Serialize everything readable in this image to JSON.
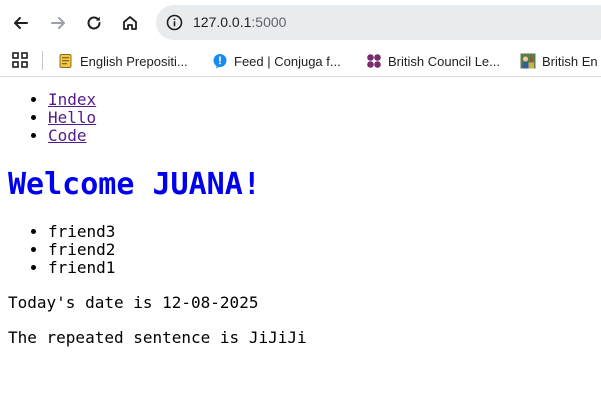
{
  "browser": {
    "url_host": "127.0.0.1",
    "url_port": ":5000",
    "bookmarks": [
      {
        "label": "English Prepositi...",
        "icon": "book-icon"
      },
      {
        "label": "Feed | Conjuga f...",
        "icon": "chat-bubble-icon"
      },
      {
        "label": "British Council Le...",
        "icon": "flower-icon"
      },
      {
        "label": "British En",
        "icon": "people-photo-icon"
      }
    ]
  },
  "page": {
    "nav_links": [
      "Index",
      "Hello",
      "Code"
    ],
    "heading": "Welcome JUANA!",
    "friends": [
      "friend3",
      "friend2",
      "friend1"
    ],
    "date_text": "Today's date is 12-08-2025",
    "repeated_text": "The repeated sentence is JiJiJi"
  },
  "colors": {
    "heading": "#0000ee",
    "visited_link": "#551a8b"
  }
}
